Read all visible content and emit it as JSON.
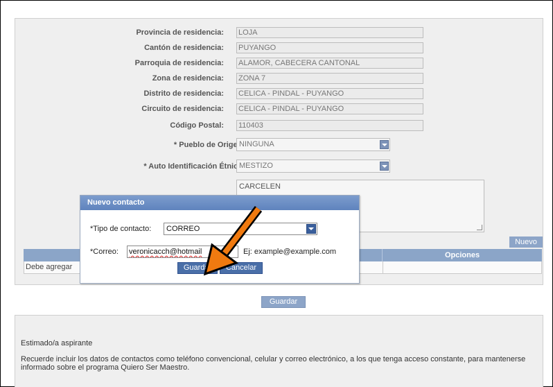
{
  "fields": [
    {
      "label": "Provincia de residencia:",
      "value": "LOJA"
    },
    {
      "label": "Cantón de residencia:",
      "value": "PUYANGO"
    },
    {
      "label": "Parroquia de residencia:",
      "value": "ALAMOR, CABECERA CANTONAL"
    },
    {
      "label": "Zona de residencia:",
      "value": "ZONA 7"
    },
    {
      "label": "Distrito de residencia:",
      "value": "CELICA - PINDAL - PUYANGO"
    },
    {
      "label": "Circuito de residencia:",
      "value": "CELICA - PINDAL - PUYANGO"
    },
    {
      "label": "Código Postal:",
      "value": "110403"
    }
  ],
  "pueblo": {
    "label": "* Pueblo de Origen:",
    "value": "NINGUNA"
  },
  "etnica": {
    "label": "* Auto Identificación Étnica:",
    "value": "MESTIZO"
  },
  "direccion": {
    "value": "CARCELEN"
  },
  "contacts": {
    "nuevo_label": "Nuevo",
    "col_options": "Opciones",
    "empty_text": "Debe agregar"
  },
  "guardar_label": "Guardar",
  "info": {
    "title": "Estimado/a aspirante",
    "text": "Recuerde incluir los datos de contactos como teléfono convencional, celular y correo electrónico, a los que tenga acceso constante, para mantenerse informado sobre el  programa Quiero Ser Maestro."
  },
  "dialog": {
    "title": "Nuevo contacto",
    "tipo_label": "*Tipo de contacto:",
    "tipo_value": "CORREO",
    "correo_label": "*Correo:",
    "correo_value": "veronicacch@hotmail",
    "hint": "Ej: example@example.com",
    "guardar": "Guardar",
    "cancelar": "Cancelar"
  },
  "colors": {
    "accent": "#8ba5c8",
    "dialog_title": "#5f83bd",
    "annotation_arrow": "#f07a10"
  }
}
